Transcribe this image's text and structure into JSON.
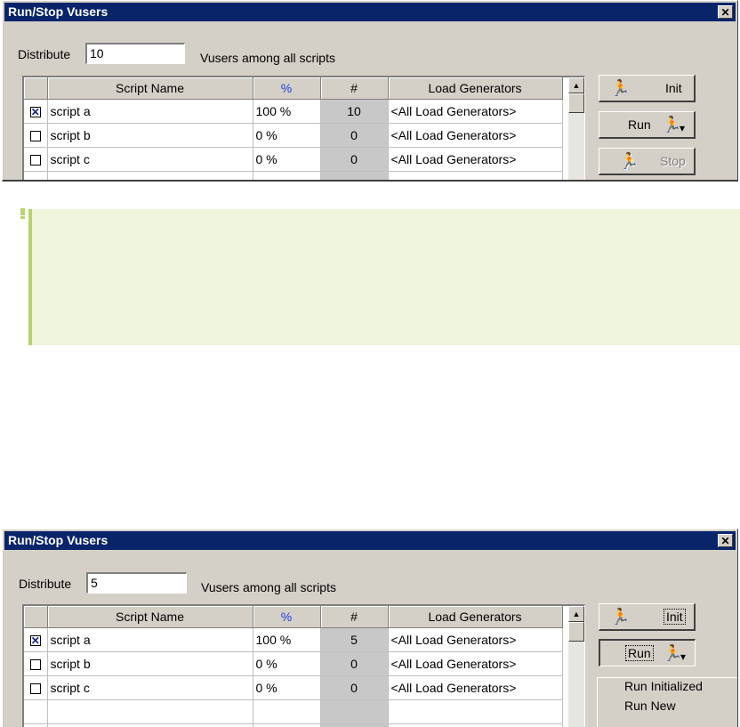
{
  "dialog1": {
    "title": "Run/Stop Vusers",
    "close_glyph": "✕",
    "distribute_label": "Distribute",
    "distribute_value": "10",
    "vusers_label": "Vusers among all scripts",
    "columns": [
      "Script Name",
      "%",
      "#",
      "Load Generators"
    ],
    "rows": [
      {
        "checked": true,
        "checkmark": "✕",
        "name": "script a",
        "pct": "100 %",
        "num": "10",
        "lg": "<All Load Generators>"
      },
      {
        "checked": false,
        "checkmark": "",
        "name": "script b",
        "pct": "0 %",
        "num": "0",
        "lg": "<All Load Generators>"
      },
      {
        "checked": false,
        "checkmark": "",
        "name": "script c",
        "pct": "0 %",
        "num": "0",
        "lg": "<All Load Generators>"
      }
    ],
    "buttons": {
      "init": "Init",
      "run": "Run",
      "stop": "Stop"
    }
  },
  "dialog2": {
    "title": "Run/Stop Vusers",
    "close_glyph": "✕",
    "distribute_label": "Distribute",
    "distribute_value": "5",
    "vusers_label": "Vusers among all scripts",
    "columns": [
      "Script Name",
      "%",
      "#",
      "Load Generators"
    ],
    "rows": [
      {
        "checked": true,
        "checkmark": "✕",
        "name": "script a",
        "pct": "100 %",
        "num": "5",
        "lg": "<All Load Generators>"
      },
      {
        "checked": false,
        "checkmark": "",
        "name": "script b",
        "pct": "0 %",
        "num": "0",
        "lg": "<All Load Generators>"
      },
      {
        "checked": false,
        "checkmark": "",
        "name": "script c",
        "pct": "0 %",
        "num": "0",
        "lg": "<All Load Generators>"
      }
    ],
    "buttons": {
      "init": "Init",
      "run": "Run"
    },
    "run_menu": [
      "Run Initialized",
      "Run New"
    ]
  },
  "icons": {
    "init": "init-flag-runner-icon",
    "run": "running-man-icon",
    "stop": "stop-runner-icon",
    "dropdown": "dropdown-arrow-icon",
    "scroll_up": "scroll-up-arrow-icon",
    "note": "note-marker-icon"
  },
  "glyphs": {
    "runner": "🏃",
    "flag_runner": "🏃",
    "dropdown": "▾",
    "scroll_up": "▲"
  },
  "colors": {
    "title_bar": "#0a246a",
    "dialog_bg": "#d4d0c8",
    "percent_header": "#1a3fd6",
    "note_bg": "#eff5dc",
    "note_border": "#b9d46a"
  }
}
